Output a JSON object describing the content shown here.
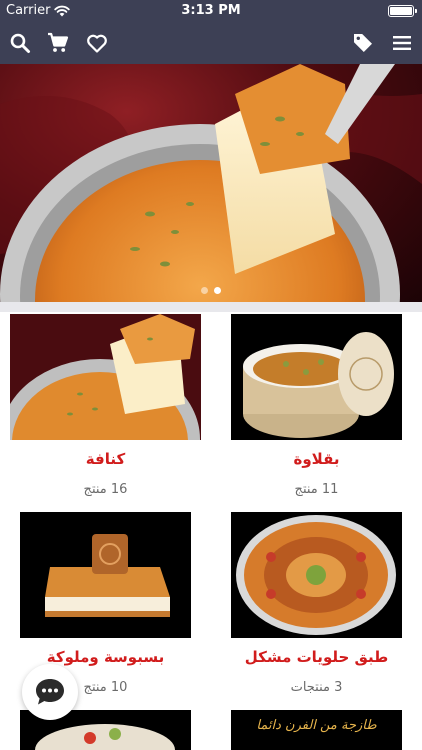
{
  "status_bar": {
    "carrier": "Carrier",
    "time": "3:13 PM"
  },
  "nav": {
    "left_icons": [
      "search-icon",
      "cart-icon",
      "heart-icon"
    ],
    "right_icons": [
      "tag-icon",
      "menu-icon"
    ]
  },
  "banner": {
    "slide_count": 2,
    "active_slide": 1
  },
  "categories": [
    {
      "title": "كنافة",
      "count": "16 منتج"
    },
    {
      "title": "بقلاوة",
      "count": "11 منتج"
    },
    {
      "title": "بسبوسة وملوكة",
      "count": "10 منتج"
    },
    {
      "title": "طبق حلويات مشكل",
      "count": "3 منتجات"
    }
  ],
  "partial_tiles": {
    "right_text": "طازجة من الفرن دائما"
  },
  "colors": {
    "bar": "#3d4055",
    "title_red": "#d11c1c",
    "separator": "#e8e8ec"
  },
  "chat": {
    "icon": "chat-icon"
  }
}
